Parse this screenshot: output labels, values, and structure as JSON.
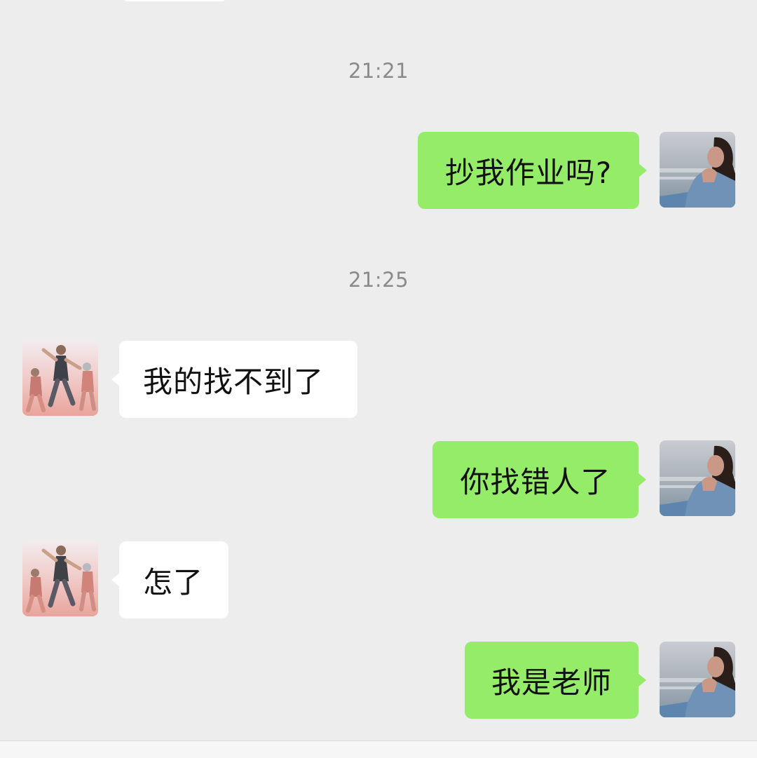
{
  "timestamps": [
    "21:21",
    "21:25"
  ],
  "messages": [
    {
      "from": "me",
      "text": "抄我作业吗?"
    },
    {
      "from": "them",
      "text": "我的找不到了"
    },
    {
      "from": "me",
      "text": "你找错人了"
    },
    {
      "from": "them",
      "text": "怎了"
    },
    {
      "from": "me",
      "text": "我是老师"
    }
  ],
  "colors": {
    "background": "#ededed",
    "outgoing_bubble": "#95ec69",
    "incoming_bubble": "#ffffff",
    "timestamp_text": "#8a8a8a"
  },
  "avatars": {
    "me": "woman-by-sea-avatar",
    "them": "dancing-group-avatar"
  }
}
